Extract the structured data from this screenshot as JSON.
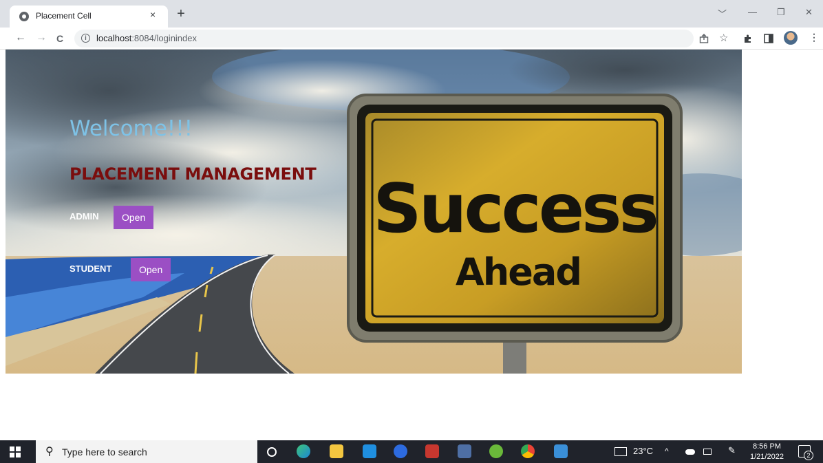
{
  "browser": {
    "tab_title": "Placement Cell",
    "tab_close": "×",
    "new_tab": "+",
    "url_host": "localhost",
    "url_rest": ":8084/loginindex",
    "window_controls": [
      "﹀",
      "—",
      "❐",
      "✕"
    ],
    "nav": {
      "back": "←",
      "forward": "→",
      "reload": "C"
    }
  },
  "page": {
    "welcome": "Welcome!!!",
    "title": "PLACEMENT MANAGEMENT",
    "admin_label": "ADMIN",
    "admin_button": "Open",
    "student_label": "STUDENT",
    "student_button": "Open",
    "sign_line1": "Success",
    "sign_line2": "Ahead",
    "button_color": "#9b4fc4",
    "welcome_color": "#7ec2e6",
    "title_color": "#7a0d0d"
  },
  "taskbar": {
    "search_placeholder": "Type here to search",
    "weather": "23°C",
    "time": "8:56 PM",
    "date": "1/21/2022",
    "notifications": "2"
  }
}
